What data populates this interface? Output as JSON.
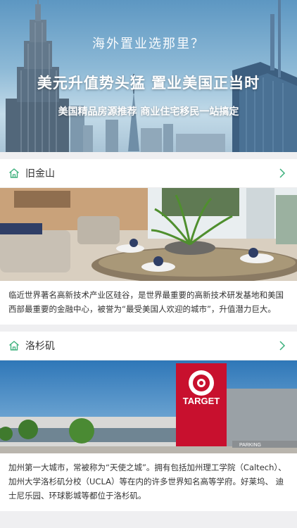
{
  "banner": {
    "question": "海外置业选那里？",
    "headline": "美元升值势头猛 置业美国正当时",
    "subheadline": "美国精品房源推荐 商业住宅移民一站搞定"
  },
  "cities": [
    {
      "name": "旧金山",
      "description": "临近世界著名高新技术产业区硅谷，是世界最重要的高新技术研发基地和美国西部最重要的金融中心，被誉为“最受美国人欢迎的城市”，升值潜力巨大。"
    },
    {
      "name": "洛杉矶",
      "description": "加州第一大城市，常被称为“天使之城”。拥有包括加州理工学院（Caltech）、加州大学洛杉矶分校（UCLA）等在内的许多世界知名高等学府。好莱坞、 迪士尼乐园、环球影城等都位于洛杉矶。",
      "store_sign": "TARGET",
      "parking_sign": "PARKING"
    }
  ],
  "colors": {
    "accent": "#3cb07c",
    "page_bg": "#efeff1"
  }
}
